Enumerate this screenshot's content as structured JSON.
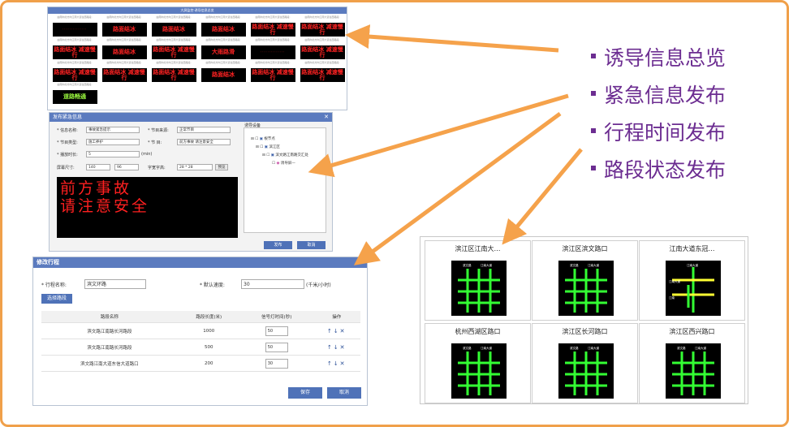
{
  "overview": {
    "title": "大屏监控·诱导信息总览",
    "cells": [
      {
        "caption": "由南向北方向江南大道往西路段:",
        "sign": "",
        "style": "dots"
      },
      {
        "caption": "由南向北方向江南大道往西路段:",
        "sign": "路面结冰",
        "style": "red"
      },
      {
        "caption": "由南向北方向江南大道往西路段:",
        "sign": "路面结冰",
        "style": "red"
      },
      {
        "caption": "由南向北方向江南大道往西路段:",
        "sign": "路面结冰",
        "style": "red"
      },
      {
        "caption": "由南向北方向江南大道往西路段:",
        "sign": "路面结冰 减速慢行",
        "style": "red"
      },
      {
        "caption": "由南向北方向江南大道往西路段:",
        "sign": "路面结冰 减速慢行",
        "style": "red"
      },
      {
        "caption": "由南向北方向江南大道往西路段:",
        "sign": "路面结冰 减速慢行",
        "style": "red"
      },
      {
        "caption": "由南向北方向江南大道往西路段:",
        "sign": "路面结冰",
        "style": "red"
      },
      {
        "caption": "由南向北方向江南大道往西路段:",
        "sign": "路面结冰 减速慢行",
        "style": "red"
      },
      {
        "caption": "由南向北方向江南大道往西路段:",
        "sign": "大雨路滑",
        "style": "red"
      },
      {
        "caption": "由南向北方向江南大道往西路段:",
        "sign": "",
        "style": "dots"
      },
      {
        "caption": "由南向北方向江南大道往西路段:",
        "sign": "路面结冰 减速慢行",
        "style": "red"
      },
      {
        "caption": "由南向北方向江南大道往西路段:",
        "sign": "路面结冰 减速慢行",
        "style": "red"
      },
      {
        "caption": "由南向北方向江南大道往西路段:",
        "sign": "路面结冰 减速慢行",
        "style": "red"
      },
      {
        "caption": "由南向北方向江南大道往西路段:",
        "sign": "路面结冰 减速慢行",
        "style": "red"
      },
      {
        "caption": "由南向北方向江南大道往西路段:",
        "sign": "路面结冰",
        "style": "red"
      },
      {
        "caption": "由南向北方向江南大道往西路段:",
        "sign": "路面结冰 减速慢行",
        "style": "red"
      },
      {
        "caption": "由南向北方向江南大道往西路段:",
        "sign": "路面结冰 减速慢行",
        "style": "red"
      }
    ],
    "last": {
      "caption": "由南向北方向江南大道往西路段:",
      "sign": "道路畅通",
      "style": "green"
    }
  },
  "publish": {
    "title": "发布紧急信息",
    "name_label": "* 信息名称:",
    "name_value": "事故紧急提示",
    "source_label": "* 节目来源:",
    "source_value": "正常节目",
    "type_label": "* 节目类型:",
    "type_value": "施工养护",
    "program_label": "* 节 目:",
    "program_value": "前方事故 请注意安全",
    "duration_label": "* 播放时长:",
    "duration_value": "5",
    "duration_unit": "(min)",
    "size_label": "屏幕尺寸:",
    "width_value": "140",
    "height_value": "96",
    "font_label": "字宽字高:",
    "font_value": "28 * 28",
    "preview_label": "预览",
    "led_line1": "前方事故",
    "led_line2": "请注意安全",
    "devices_label": "诱导设备",
    "tree": [
      "根节点",
      "滨江区",
      "滨文路江南路交汇处",
      "诱导屏—"
    ],
    "publish_button": "发布",
    "cancel_button": "取消"
  },
  "trip": {
    "title": "修改行程",
    "trip_name_label": "* 行程名称:",
    "trip_name_value": "滨文环路",
    "speed_label": "* 默认速度:",
    "speed_value": "30",
    "speed_unit": "(千米/小时)",
    "select_route_button": "选择路段",
    "columns": [
      "路段名称",
      "路段长度(米)",
      "信号灯时间(秒)",
      "操作"
    ],
    "rows": [
      {
        "name": "滨文路江南路长河路段",
        "length": "1000",
        "signal": "50"
      },
      {
        "name": "滨文路江南路长河路段",
        "length": "500",
        "signal": "50"
      },
      {
        "name": "滨文路江南大道东信大道路口",
        "length": "200",
        "signal": "30"
      }
    ],
    "ops": "↑↓✕",
    "save_button": "保存",
    "cancel_button": "取消"
  },
  "features": [
    "诱导信息总览",
    "紧急信息发布",
    "行程时间发布",
    "路段状态发布"
  ],
  "maps": [
    {
      "title": "滨江区江南大…",
      "signs": [
        "滨文路",
        "江南大道"
      ],
      "highlight": false
    },
    {
      "title": "滨江区滨文路口",
      "signs": [
        "滨文路",
        "江南大道"
      ],
      "highlight": false
    },
    {
      "title": "江南大道东冠…",
      "signs": [
        "江南大道",
        "江南大道",
        "江南"
      ],
      "highlight": true
    },
    {
      "title": "杭州西湖区路口",
      "signs": [
        "滨文路",
        "江南大道"
      ],
      "highlight": false
    },
    {
      "title": "滨江区长河路口",
      "signs": [
        "滨文路",
        "江南大道"
      ],
      "highlight": false
    },
    {
      "title": "滨江区西兴路口",
      "signs": [
        "滨文路",
        "江南大道"
      ],
      "highlight": false
    }
  ],
  "colors": {
    "accent": "#f5a24b",
    "bullet": "#6c2d91",
    "header": "#5b7bbf",
    "road": "#33ff33",
    "road_alt": "#ffff33"
  }
}
